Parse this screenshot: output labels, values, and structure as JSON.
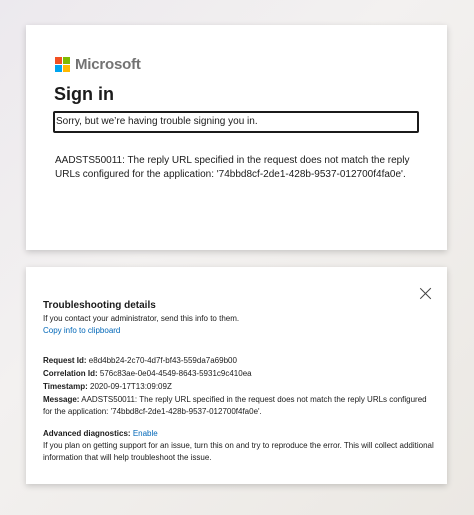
{
  "signin": {
    "brand": "Microsoft",
    "title": "Sign in",
    "error_message": "Sorry, but we’re having trouble signing you in.",
    "error_detail": "AADSTS50011: The reply URL specified in the request does not match the reply URLs configured for the application: '74bbd8cf-2de1-428b-9537-012700f4fa0e'."
  },
  "logo_colors": [
    "#f25022",
    "#7fba00",
    "#00a4ef",
    "#ffb900"
  ],
  "troubleshooting": {
    "title": "Troubleshooting details",
    "intro": "If you contact your administrator, send this info to them.",
    "copy_link": "Copy info to clipboard",
    "request_id_label": "Request Id:",
    "request_id": "e8d4bb24-2c70-4d7f-bf43-559da7a69b00",
    "correlation_id_label": "Correlation Id:",
    "correlation_id": "576c83ae-0e04-4549-8643-5931c9c410ea",
    "timestamp_label": "Timestamp:",
    "timestamp": "2020-09-17T13:09:09Z",
    "message_label": "Message:",
    "message": "AADSTS50011: The reply URL specified in the request does not match the reply URLs configured for the application: '74bbd8cf-2de1-428b-9537-012700f4fa0e'.",
    "diagnostics_label": "Advanced diagnostics:",
    "diagnostics_link": "Enable",
    "diagnostics_text": "If you plan on getting support for an issue, turn this on and try to reproduce the error. This will collect additional information that will help troubleshoot the issue."
  },
  "colors": {
    "link": "#0067b8",
    "text": "#1b1b1b"
  }
}
